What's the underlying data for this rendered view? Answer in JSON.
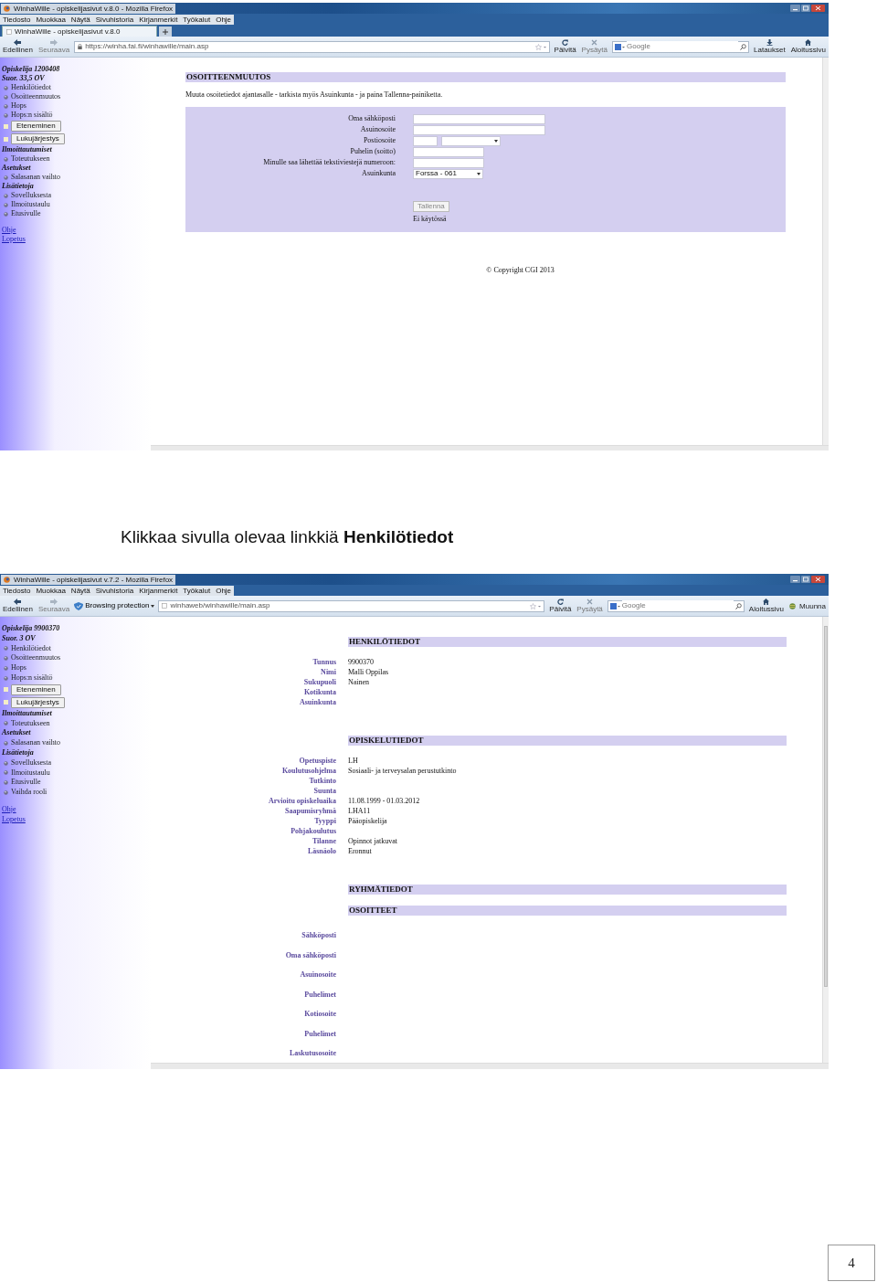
{
  "screenshots": [
    {
      "window": {
        "title": "WinhaWille - opiskelijasivut v.8.0 - Mozilla Firefox"
      },
      "menu": [
        "Tiedosto",
        "Muokkaa",
        "Näytä",
        "Sivuhistoria",
        "Kirjanmerkit",
        "Työkalut",
        "Ohje"
      ],
      "tabs": [
        {
          "label": "WinhaWille - opiskelijasivut v.8.0",
          "selected": true
        }
      ],
      "toolbar": {
        "back": "Edellinen",
        "forward": "Seuraava",
        "url": "https://winha.fai.fi/winhawille/main.asp",
        "reload": "Päivitä",
        "stop": "Pysäytä",
        "search_placeholder": "Google",
        "buttons": [
          {
            "kind": "download",
            "label": "Lataukset"
          },
          {
            "kind": "home",
            "label": "Aloitussivu"
          }
        ]
      },
      "sidebar": {
        "student": "Opiskelija 1200408",
        "credits": "Suor. 33,5 OV",
        "items": [
          {
            "kind": "link",
            "label": "Henkilötiedot"
          },
          {
            "kind": "link",
            "label": "Osoitteenmuutos"
          },
          {
            "kind": "link",
            "label": "Hops"
          },
          {
            "kind": "link",
            "label": "Hops:n sisältö"
          },
          {
            "kind": "button",
            "label": "Eteneminen"
          },
          {
            "kind": "button",
            "label": "Lukujärjestys"
          },
          {
            "kind": "heading",
            "label": "Ilmoittautumiset"
          },
          {
            "kind": "link",
            "label": "Toteutukseen"
          },
          {
            "kind": "heading",
            "label": "Asetukset"
          },
          {
            "kind": "link",
            "label": "Salasanan vaihto"
          },
          {
            "kind": "heading",
            "label": "Lisätietoja"
          },
          {
            "kind": "link",
            "label": "Sovelluksesta"
          },
          {
            "kind": "link",
            "label": "Ilmoitustaulu"
          },
          {
            "kind": "link",
            "label": "Etusivulle"
          },
          {
            "kind": "plain",
            "label": "Ohje"
          },
          {
            "kind": "plain",
            "label": "Lopetus"
          }
        ]
      },
      "form": {
        "title": "OSOITTEENMUUTOS",
        "instructions": "Muuta osoitetiedot ajantasalle - tarkista myös Asuinkunta - ja paina Tallenna-painiketta.",
        "fields": [
          {
            "label": "Oma sähköposti",
            "kind": "text"
          },
          {
            "label": "Asuinosoite",
            "kind": "text"
          },
          {
            "label": "Postiosoite",
            "kind": "postal"
          },
          {
            "label": "Puhelin (soitto)",
            "kind": "short"
          },
          {
            "label": "Minulle saa lähettää tekstiviestejä numeroon:",
            "kind": "short"
          },
          {
            "label": "Asuinkunta",
            "kind": "select",
            "value": "Forssa - 061"
          }
        ],
        "button": {
          "label": "Tallenna",
          "disabled": true
        },
        "note": "Ei käytössä"
      },
      "footer": "© Copyright CGI 2013"
    },
    {
      "window": {
        "title": "WinhaWille - opiskelijasivut v.7.2 - Mozilla Firefox"
      },
      "menu": [
        "Tiedosto",
        "Muokkaa",
        "Näytä",
        "Sivuhistoria",
        "Kirjanmerkit",
        "Työkalut",
        "Ohje"
      ],
      "toolbar": {
        "back": "Edellinen",
        "forward": "Seuraava",
        "protection": "Browsing protection",
        "url": "winhaweb/winhawille/main.asp",
        "reload": "Päivitä",
        "stop": "Pysäytä",
        "search_placeholder": "Google",
        "buttons": [
          {
            "kind": "home",
            "label": "Aloitussivu"
          },
          {
            "kind": "convert",
            "label": "Muunna"
          }
        ]
      },
      "sidebar": {
        "student": "Opiskelija 9900370",
        "credits": "Suor. 3 OV",
        "items": [
          {
            "kind": "link",
            "label": "Henkilötiedot"
          },
          {
            "kind": "link",
            "label": "Osoitteenmuutos"
          },
          {
            "kind": "link",
            "label": "Hops"
          },
          {
            "kind": "link",
            "label": "Hops:n sisältö"
          },
          {
            "kind": "button",
            "label": "Eteneminen"
          },
          {
            "kind": "button",
            "label": "Lukujärjestys"
          },
          {
            "kind": "heading",
            "label": "Ilmoittautumiset"
          },
          {
            "kind": "link",
            "label": "Toteutukseen"
          },
          {
            "kind": "heading",
            "label": "Asetukset"
          },
          {
            "kind": "link",
            "label": "Salasanan vaihto"
          },
          {
            "kind": "heading",
            "label": "Lisätietoja"
          },
          {
            "kind": "link",
            "label": "Sovelluksesta"
          },
          {
            "kind": "link",
            "label": "Ilmoitustaulu"
          },
          {
            "kind": "link",
            "label": "Etusivulle"
          },
          {
            "kind": "link",
            "label": "Vaihda rooli"
          },
          {
            "kind": "plain",
            "label": "Ohje"
          },
          {
            "kind": "plain",
            "label": "Lopetus"
          }
        ]
      },
      "sections": [
        {
          "title": "HENKILÖTIEDOT",
          "rows": [
            {
              "label": "Tunnus",
              "value": "9900370"
            },
            {
              "label": "Nimi",
              "value": "Malli Oppilas"
            },
            {
              "label": "Sukupuoli",
              "value": "Nainen"
            },
            {
              "label": "Kotikunta"
            },
            {
              "label": "Asuinkunta"
            }
          ]
        },
        {
          "title": "OPISKELUTIEDOT",
          "rows": [
            {
              "label": "Opetuspiste",
              "value": "LH"
            },
            {
              "label": "Koulutusohjelma",
              "value": "Sosiaali- ja terveysalan perustutkinto"
            },
            {
              "label": "Tutkinto"
            },
            {
              "label": "Suunta"
            },
            {
              "label": "Arvioitu opiskeluaika",
              "value": "11.08.1999 - 01.03.2012"
            },
            {
              "label": "Saapumisryhmä",
              "value": "LHA11"
            },
            {
              "label": "Tyyppi",
              "value": "Pääopiskelija"
            },
            {
              "label": "Pohjakoulutus"
            },
            {
              "label": "Tilanne",
              "value": "Opinnot jatkuvat"
            },
            {
              "label": "Läsnäolo",
              "value": "Eronnut"
            }
          ]
        },
        {
          "title": "RYHMÄTIEDOT"
        },
        {
          "title": "OSOITTEET",
          "rows": [
            {
              "label": "Sähköposti"
            },
            {
              "label": "Oma sähköposti"
            },
            {
              "label": "Asuinosoite"
            },
            {
              "label": "Puhelimet"
            },
            {
              "label": "Kotiosoite"
            },
            {
              "label": "Puhelimet"
            },
            {
              "label": "Laskutusosoite"
            }
          ]
        }
      ]
    }
  ],
  "caption": "Klikkaa sivulla olevaa linkkiä **Henkilötiedot**",
  "page_number": "4"
}
